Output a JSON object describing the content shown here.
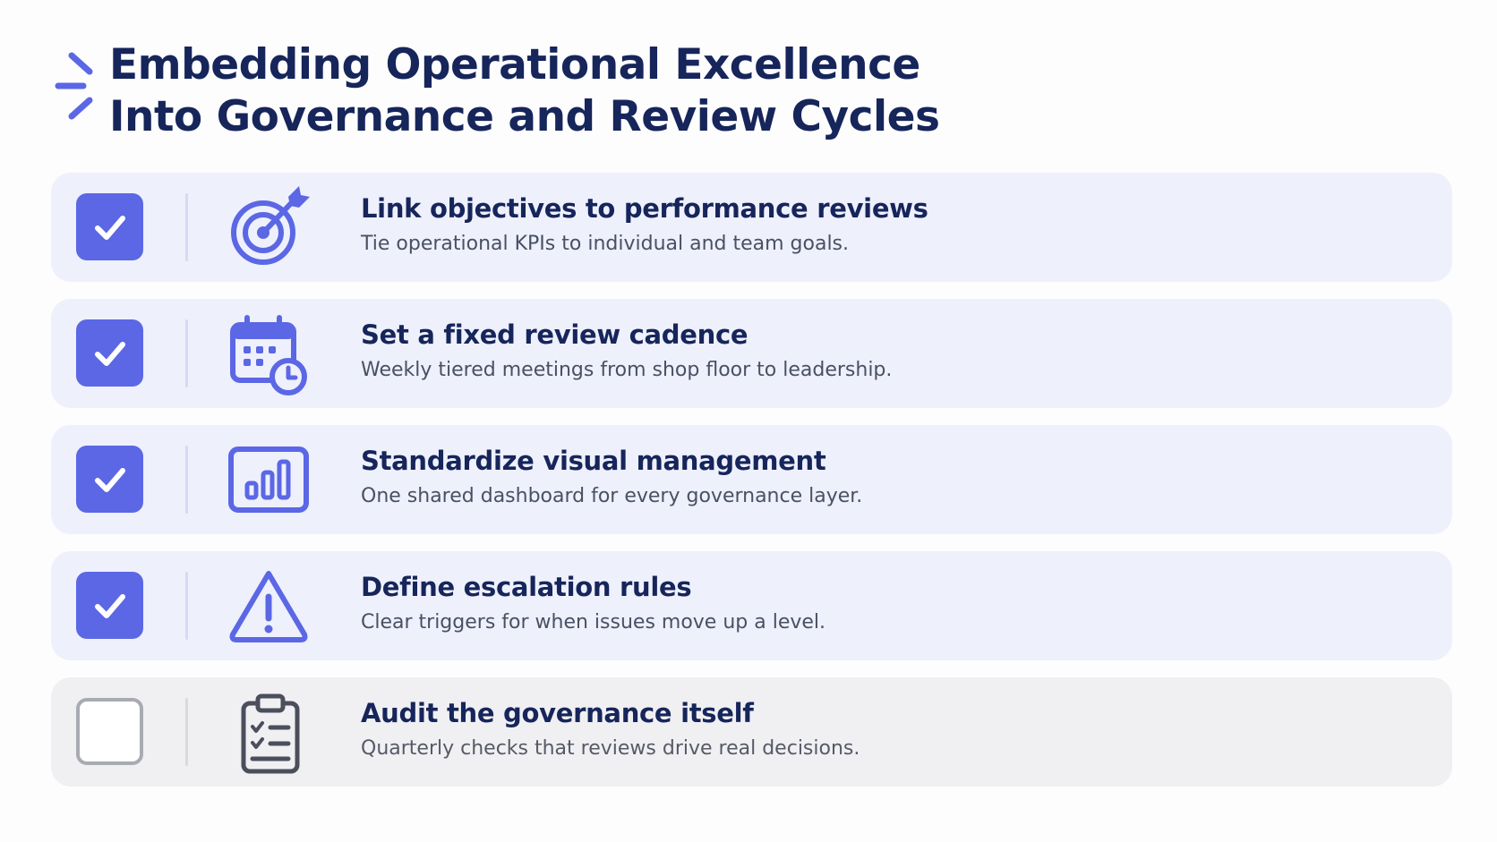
{
  "title": {
    "line1": "Embedding Operational Excellence",
    "line2": "Into Governance and Review Cycles"
  },
  "colors": {
    "accent": "#5b67e5",
    "title": "#16255a",
    "row_done_bg": "#eef0fc",
    "row_pending_bg": "#f0f0f3"
  },
  "items": [
    {
      "checked": true,
      "icon": "target-icon",
      "title": "Link objectives to performance reviews",
      "description": "Tie operational KPIs to individual and team goals."
    },
    {
      "checked": true,
      "icon": "calendar-clock-icon",
      "title": "Set a fixed review cadence",
      "description": "Weekly tiered meetings from shop floor to leadership."
    },
    {
      "checked": true,
      "icon": "bar-chart-icon",
      "title": "Standardize visual management",
      "description": "One shared dashboard for every governance layer."
    },
    {
      "checked": true,
      "icon": "warning-triangle-icon",
      "title": "Define escalation rules",
      "description": "Clear triggers for when issues move up a level."
    },
    {
      "checked": false,
      "icon": "clipboard-checklist-icon",
      "title": "Audit the governance itself",
      "description": "Quarterly checks that reviews drive real decisions."
    }
  ]
}
